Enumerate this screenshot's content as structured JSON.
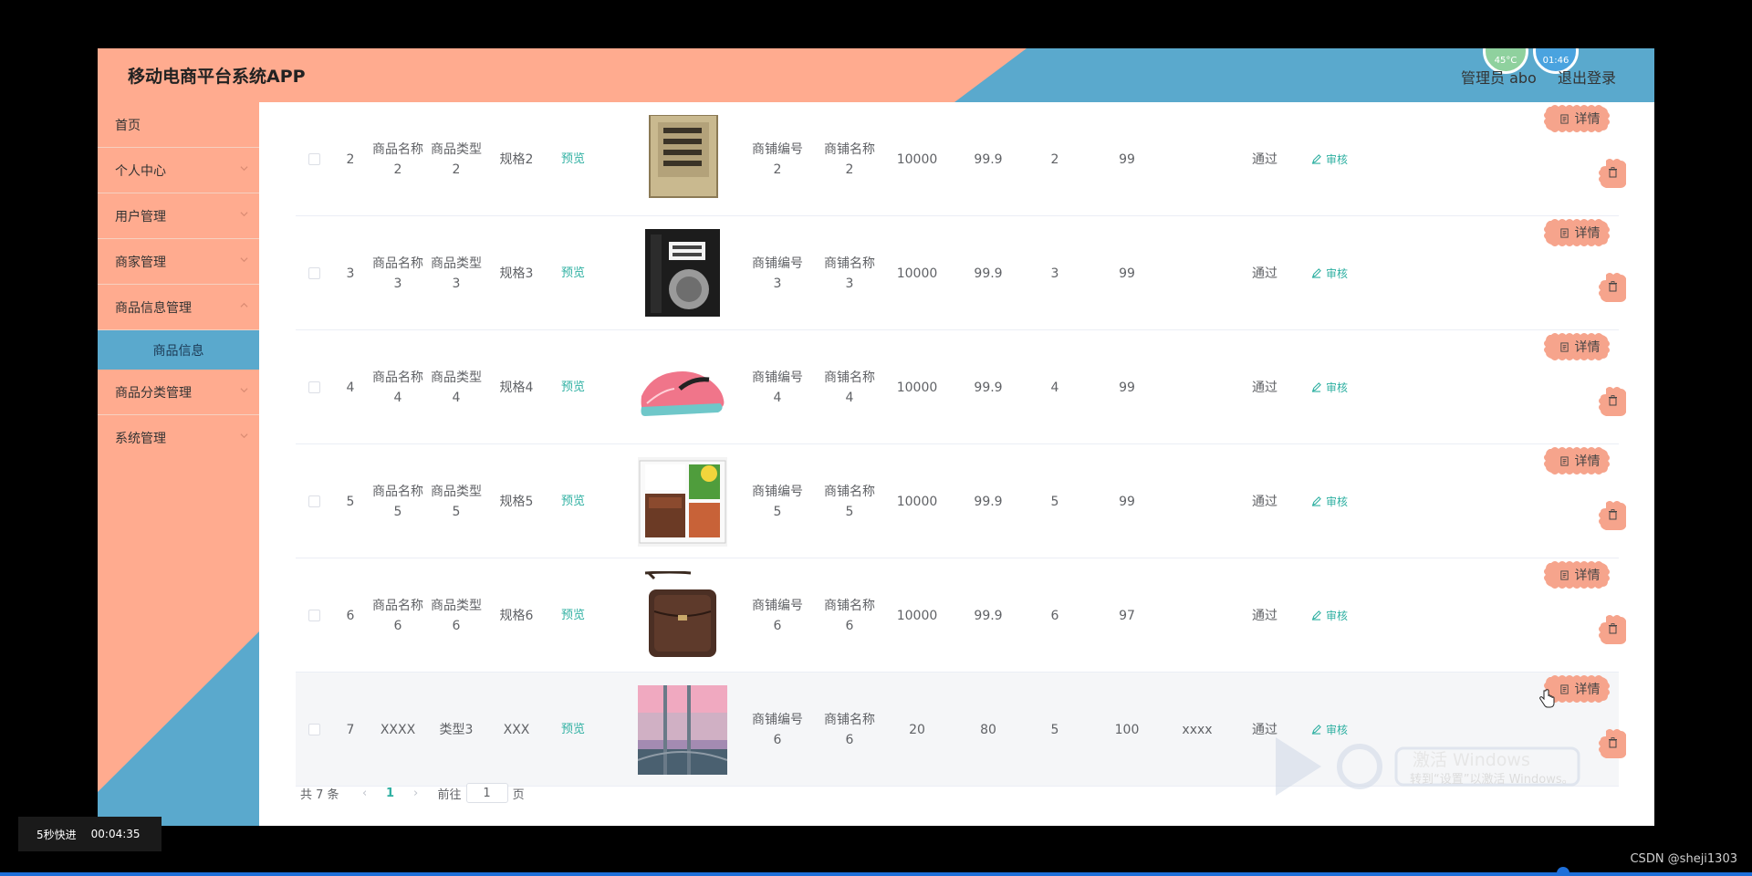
{
  "header": {
    "title": "移动电商平台系统APP",
    "admin": "管理员 abo",
    "logout": "退出登录",
    "gadget_left": "45°C",
    "gadget_right": "01:46"
  },
  "sidebar": {
    "items": [
      {
        "label": "首页"
      },
      {
        "label": "个人中心"
      },
      {
        "label": "用户管理"
      },
      {
        "label": "商家管理"
      },
      {
        "label": "商品信息管理"
      },
      {
        "label": "商品分类管理"
      },
      {
        "label": "系统管理"
      }
    ],
    "active_sub": "商品信息"
  },
  "table": {
    "preview_label": "预览",
    "audit_label": "审核",
    "detail_label": "详情",
    "rows": [
      {
        "id": "2",
        "name": "商品名称\n2",
        "type": "商品类型\n2",
        "spec": "规格2",
        "shop_no": "商铺编号\n2",
        "shop_name": "商铺名称\n2",
        "stock": "10000",
        "price": "99.9",
        "c1": "2",
        "c2": "99",
        "c3": "",
        "status": "通过"
      },
      {
        "id": "3",
        "name": "商品名称\n3",
        "type": "商品类型\n3",
        "spec": "规格3",
        "shop_no": "商铺编号\n3",
        "shop_name": "商铺名称\n3",
        "stock": "10000",
        "price": "99.9",
        "c1": "3",
        "c2": "99",
        "c3": "",
        "status": "通过"
      },
      {
        "id": "4",
        "name": "商品名称\n4",
        "type": "商品类型\n4",
        "spec": "规格4",
        "shop_no": "商铺编号\n4",
        "shop_name": "商铺名称\n4",
        "stock": "10000",
        "price": "99.9",
        "c1": "4",
        "c2": "99",
        "c3": "",
        "status": "通过"
      },
      {
        "id": "5",
        "name": "商品名称\n5",
        "type": "商品类型\n5",
        "spec": "规格5",
        "shop_no": "商铺编号\n5",
        "shop_name": "商铺名称\n5",
        "stock": "10000",
        "price": "99.9",
        "c1": "5",
        "c2": "99",
        "c3": "",
        "status": "通过"
      },
      {
        "id": "6",
        "name": "商品名称\n6",
        "type": "商品类型\n6",
        "spec": "规格6",
        "shop_no": "商铺编号\n6",
        "shop_name": "商铺名称\n6",
        "stock": "10000",
        "price": "99.9",
        "c1": "6",
        "c2": "97",
        "c3": "",
        "status": "通过"
      },
      {
        "id": "7",
        "name": "XXXX",
        "type": "类型3",
        "spec": "XXX",
        "shop_no": "商铺编号\n6",
        "shop_name": "商铺名称\n6",
        "stock": "20",
        "price": "80",
        "c1": "5",
        "c2": "100",
        "c3": "xxxx",
        "status": "通过"
      }
    ]
  },
  "pagination": {
    "total": "共 7 条",
    "current": "1",
    "goto_prefix": "前往",
    "goto_value": "1",
    "goto_suffix": "页"
  },
  "overlay": {
    "watermark_line1": "激活 Windows",
    "watermark_line2": "转到“设置”以激活 Windows。",
    "skip_label": "5秒快进",
    "time": "00:04:35",
    "credit": "CSDN @sheji1303"
  },
  "colors": {
    "salmon": "#ffab8f",
    "blue": "#5aa9cd",
    "teal": "#2fb0a2",
    "button": "#f6a48c"
  }
}
